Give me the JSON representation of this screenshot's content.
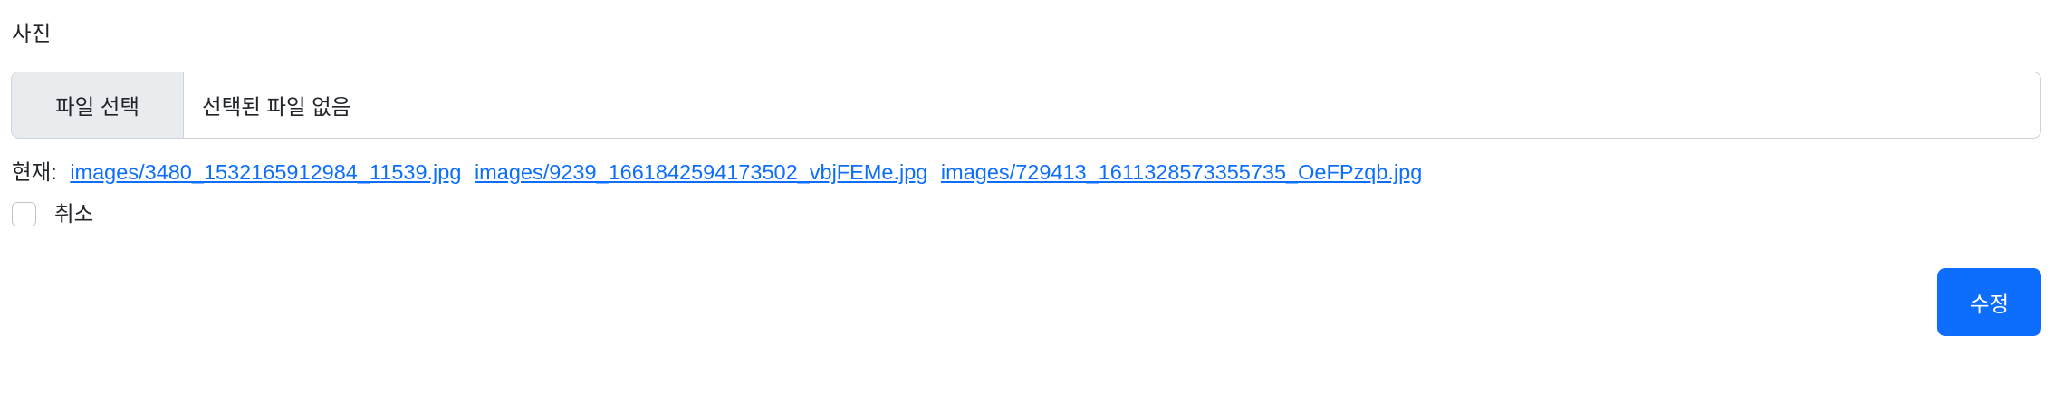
{
  "form": {
    "photo_label": "사진",
    "file_button_label": "파일 선택",
    "file_status": "선택된 파일 없음",
    "current_label": "현재:",
    "current_files": [
      "images/3480_1532165912984_11539.jpg",
      "images/9239_1661842594173502_vbjFEMe.jpg",
      "images/729413_1611328573355735_OeFPzqb.jpg"
    ],
    "clear_label": "취소",
    "clear_checked": false,
    "submit_label": "수정"
  },
  "colors": {
    "primary": "#0d6efd",
    "border": "#ced4da",
    "file_button_bg": "#e9ecef"
  }
}
